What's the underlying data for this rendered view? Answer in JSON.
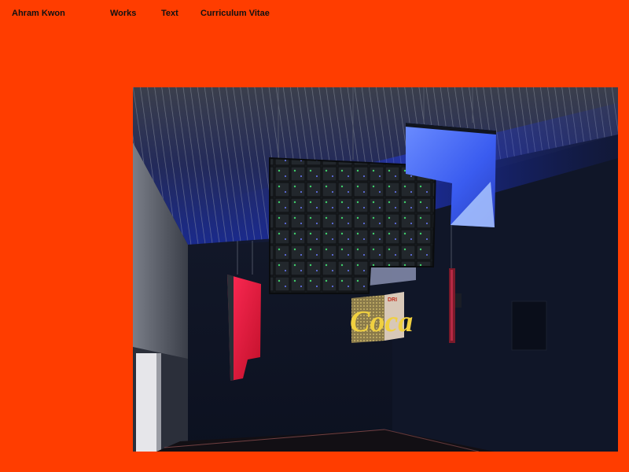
{
  "site": {
    "name": "Ahram Kwon"
  },
  "nav": {
    "items": [
      {
        "label": "Works"
      },
      {
        "label": "Text"
      },
      {
        "label": "Curriculum Vitae"
      }
    ]
  },
  "colors": {
    "page_background": "#ff3d00",
    "text": "#111111"
  },
  "artwork": {
    "sign_text": "Coca",
    "sign_small_text": "DRI"
  }
}
